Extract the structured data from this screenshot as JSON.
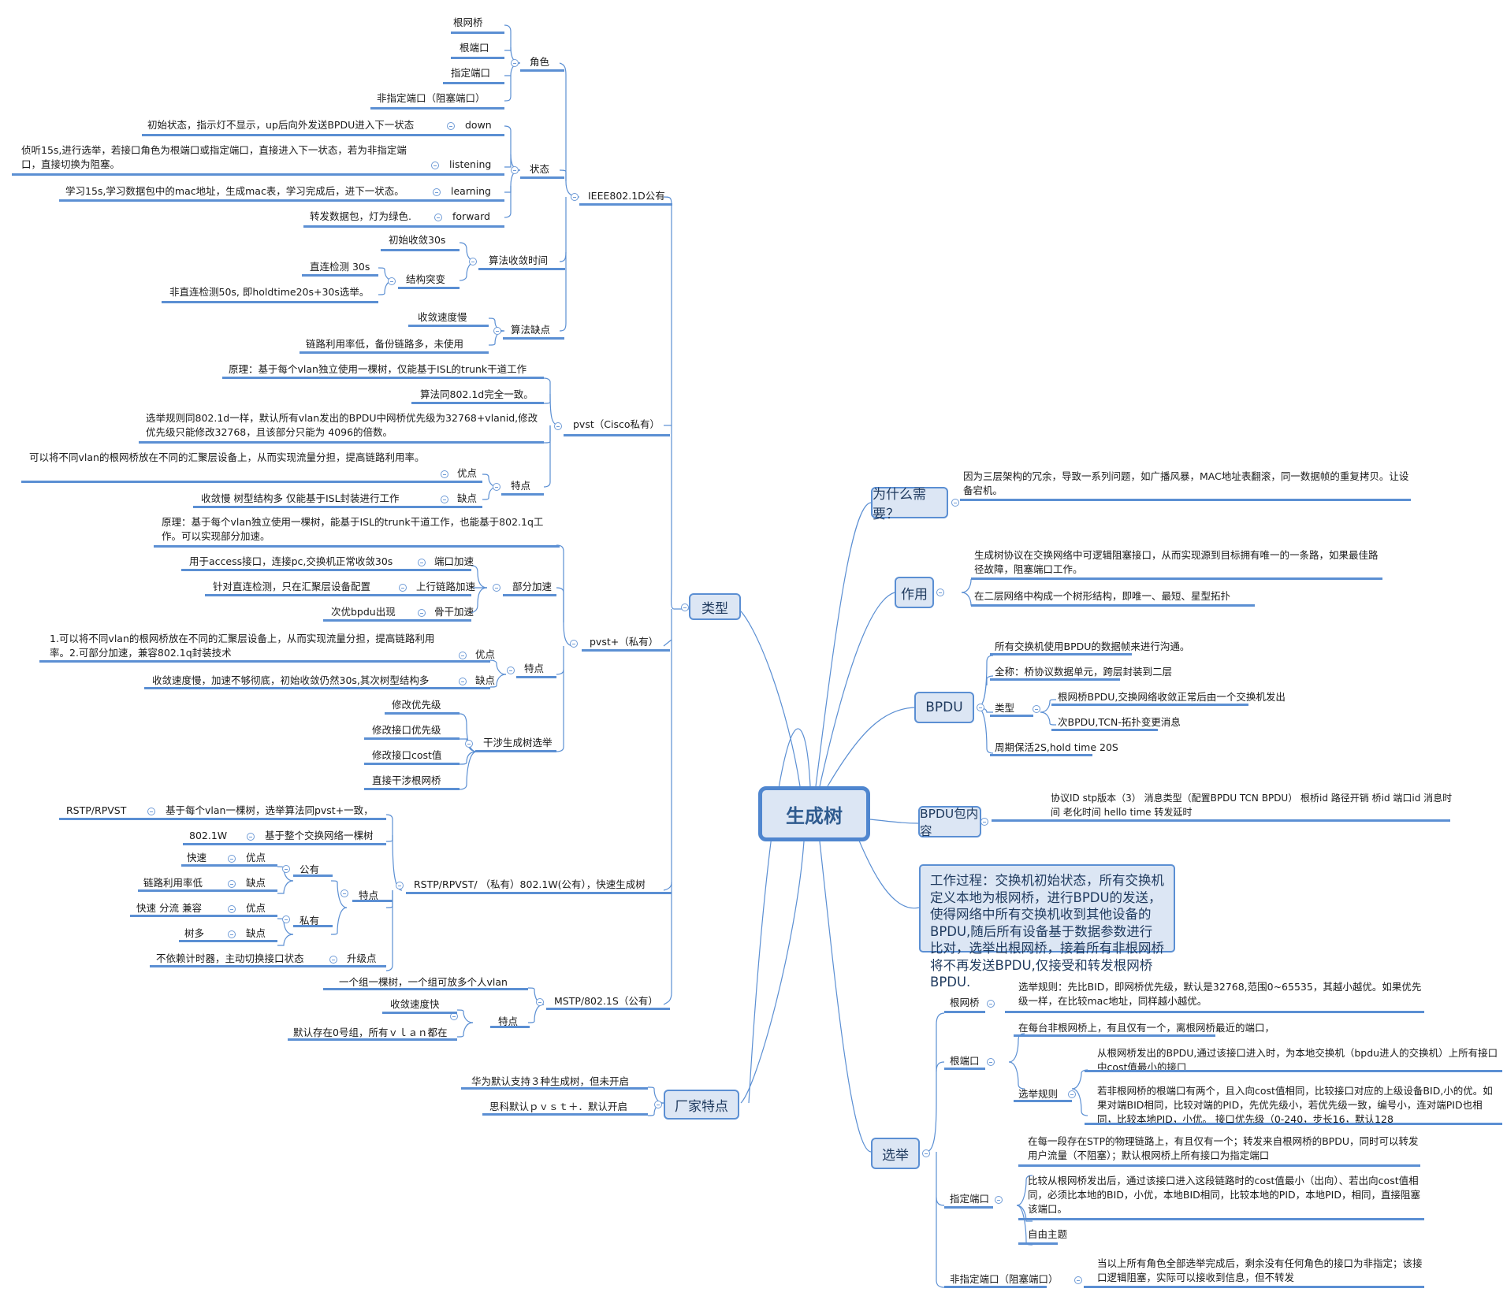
{
  "center": {
    "label": "生成树"
  },
  "colors": {
    "line": "#5b8fd3",
    "box_fill": "#dce6f4",
    "box_border": "#5b8fd3",
    "center_text": "#2f5b8f"
  },
  "left": {
    "types": {
      "label": "类型",
      "ieee": {
        "label": "IEEE802.1D公有",
        "roles": {
          "label": "角色",
          "items": [
            "根网桥",
            "根端口",
            "指定端口",
            "非指定端口（阻塞端口）"
          ]
        },
        "states": {
          "label": "状态",
          "items": [
            {
              "name": "down",
              "desc": "初始状态，指示灯不显示，up后向外发送BPDU进入下一状态"
            },
            {
              "name": "listening",
              "desc": "侦听15s,进行选举，若接口角色为根端口或指定端口，直接进入下一状态，若为非指定端口，直接切换为阻塞。"
            },
            {
              "name": "learning",
              "desc": "学习15s,学习数据包中的mac地址，生成mac表，学习完成后，进下一状态。"
            },
            {
              "name": "forward",
              "desc": "转发数据包，灯为绿色."
            }
          ]
        },
        "convergence": {
          "label": "算法收敛时间",
          "initial": "初始收敛30s",
          "mutation": {
            "label": "结构突变",
            "items": [
              "直连检测 30s",
              "非直连检测50s, 即holdtime20s+30s选举。"
            ]
          }
        },
        "drawbacks": {
          "label": "算法缺点",
          "items": [
            "收敛速度慢",
            "链路利用率低，备份链路多，未使用"
          ]
        }
      },
      "pvst": {
        "label": "pvst（Cisco私有）",
        "items": [
          "原理：基于每个vlan独立使用一棵树，仅能基于ISL的trunk干道工作",
          "算法同802.1d完全一致。",
          "选举规则同802.1d一样，默认所有vlan发出的BPDU中网桥优先级为32768+vlanid,修改优先级只能修改32768，且该部分只能为 4096的倍数。"
        ],
        "features": {
          "label": "特点",
          "pro": {
            "label": "优点",
            "desc": "可以将不同vlan的根网桥放在不同的汇聚层设备上，从而实现流量分担，提高链路利用率。"
          },
          "con": {
            "label": "缺点",
            "desc": "收敛慢   树型结构多   仅能基于ISL封装进行工作"
          }
        }
      },
      "pvstplus": {
        "label": "pvst+（私有）",
        "principle": "原理：基于每个vlan独立使用一棵树，能基于ISL的trunk干道工作，也能基于802.1q工作。可以实现部分加速。",
        "accel": {
          "label": "部分加速",
          "items": [
            {
              "name": "端口加速",
              "desc": "用于access接口，连接pc,交换机正常收敛30s"
            },
            {
              "name": "上行链路加速",
              "desc": "针对直连检测，只在汇聚层设备配置"
            },
            {
              "name": "骨干加速",
              "desc": "次优bpdu出现"
            }
          ]
        },
        "features": {
          "label": "特点",
          "pro": {
            "label": "优点",
            "desc": "1.可以将不同vlan的根网桥放在不同的汇聚层设备上，从而实现流量分担，提高链路利用率。2.可部分加速，兼容802.1q封装技术"
          },
          "con": {
            "label": "缺点",
            "desc": "收敛速度慢，加速不够彻底，初始收敛仍然30s,其次树型结构多"
          }
        },
        "intervene": {
          "label": "干涉生成树选举",
          "items": [
            "修改优先级",
            "修改接口优先级",
            "修改接口cost值",
            "直接干涉根网桥"
          ]
        }
      },
      "rstp": {
        "label": "RSTP/RPVST/  （私有）802.1W(公有），快速生成树",
        "rpvst": {
          "name": "基于每个vlan一棵树，选举算法同pvst+一致，",
          "desc": "RSTP/RPVST"
        },
        "w": {
          "name": "基于整个交换网络一棵树",
          "desc": "802.1W"
        },
        "features": {
          "label": "特点",
          "public": {
            "label": "公有",
            "pro": {
              "label": "优点",
              "desc": "快速"
            },
            "con": {
              "label": "缺点",
              "desc": "链路利用率低"
            }
          },
          "private": {
            "label": "私有",
            "pro": {
              "label": "优点",
              "desc": "快速 分流 兼容"
            },
            "con": {
              "label": "缺点",
              "desc": "树多"
            }
          }
        },
        "upgrade": {
          "label": "升级点",
          "desc": "不依赖计时器，主动切换接口状态"
        }
      },
      "mstp": {
        "label": "MSTP/802.1S（公有）",
        "item": "一个组一棵树，一个组可放多个人vlan",
        "features": {
          "label": "特点",
          "items": [
            "收敛速度快",
            "默认存在0号组，所有ｖｌａｎ都在"
          ]
        }
      }
    },
    "vendor": {
      "label": "厂家特点",
      "items": [
        "华为默认支持３种生成树，但未开启",
        "思科默认ｐｖｓｔ＋．默认开启"
      ]
    }
  },
  "right": {
    "why": {
      "label": "为什么需要？",
      "desc": "因为三层架构的冗余，导致一系列问题，如广播风暴，MAC地址表翻滚，同一数据帧的重复拷贝。让设备宕机。"
    },
    "role": {
      "label": "作用",
      "items": [
        "生成树协议在交换网络中可逻辑阻塞接口，从而实现源到目标拥有唯一的一条路，如果最佳路径故障，阻塞端口工作。",
        "在二层网络中构成一个树形结构，即唯一、最短、星型拓扑"
      ]
    },
    "bpdu": {
      "label": "BPDU",
      "items": [
        "所有交换机使用BPDU的数据帧来进行沟通。",
        "全称：桥协议数据单元，跨层封装到二层"
      ],
      "types": {
        "label": "类型",
        "items": [
          "根网桥BPDU,交换网络收敛正常后由一个交换机发出",
          "次BPDU,TCN-拓扑变更消息"
        ]
      },
      "keepalive": "周期保活2S,hold time 20S"
    },
    "bpdu_content": {
      "label": "BPDU包内容",
      "desc": "协议ID   stp版本（3）   消息类型（配置BPDU  TCN BPDU）   根桥id   路径开销   桥id   端口id    消息时间    老化时间      hello time       转发延时"
    },
    "work": {
      "text": "工作过程：交换机初始状态，所有交换机定义本地为根网桥，进行BPDU的发送，使得网络中所有交换机收到其他设备的BPDU,随后所有设备基于数据参数进行比对，选举出根网桥，接着所有非根网桥将不再发送BPDU,仅接受和转发根网桥BPDU."
    },
    "election": {
      "label": "选举",
      "root_bridge": {
        "label": "根网桥",
        "desc": "选举规则：先比BID，即网桥优先级，默认是32768,范围0~65535，其越小越优。如果优先级一样，在比较mac地址，同样越小越优。"
      },
      "root_port": {
        "label": "根端口",
        "desc": "在每台非根网桥上，有且仅有一个，离根网桥最近的端口，",
        "rules": {
          "label": "选举规则",
          "items": [
            "从根网桥发出的BPDU,通过该接口进入时，为本地交换机（bpdu进人的交换机）上所有接口中cost值最小的接口",
            "若非根网桥的根端口有两个，且入向cost值相同，比较接口对应的上级设备BID,小的优。如果对端BID相同，比较对端的PID，先优先级小，若优先级一致，编号小，连对端PID也相同，比较本地PID，小优。 接口优先级（0-240，步长16，默认128"
          ]
        }
      },
      "designated": {
        "label": "指定端口",
        "items": [
          "在每一段存在STP的物理链路上，有且仅有一个；转发来自根网桥的BPDU，同时可以转发用户流量（不阻塞）；默认根网桥上所有接口为指定端口",
          "比较从根网桥发出后，通过该接口进入这段链路时的cost值最小（出向）、若出向cost值相同，必须比本地的BID，小优，本地BID相同，比较本地的PID，本地PID，相同，直接阻塞该端口。",
          "自由主题"
        ]
      },
      "non_designated": {
        "label": "非指定端口（阻塞端口）",
        "desc": "当以上所有角色全部选举完成后，剩余没有任何角色的接口为非指定；该接口逻辑阻塞，实际可以接收到信息，但不转发"
      }
    }
  }
}
